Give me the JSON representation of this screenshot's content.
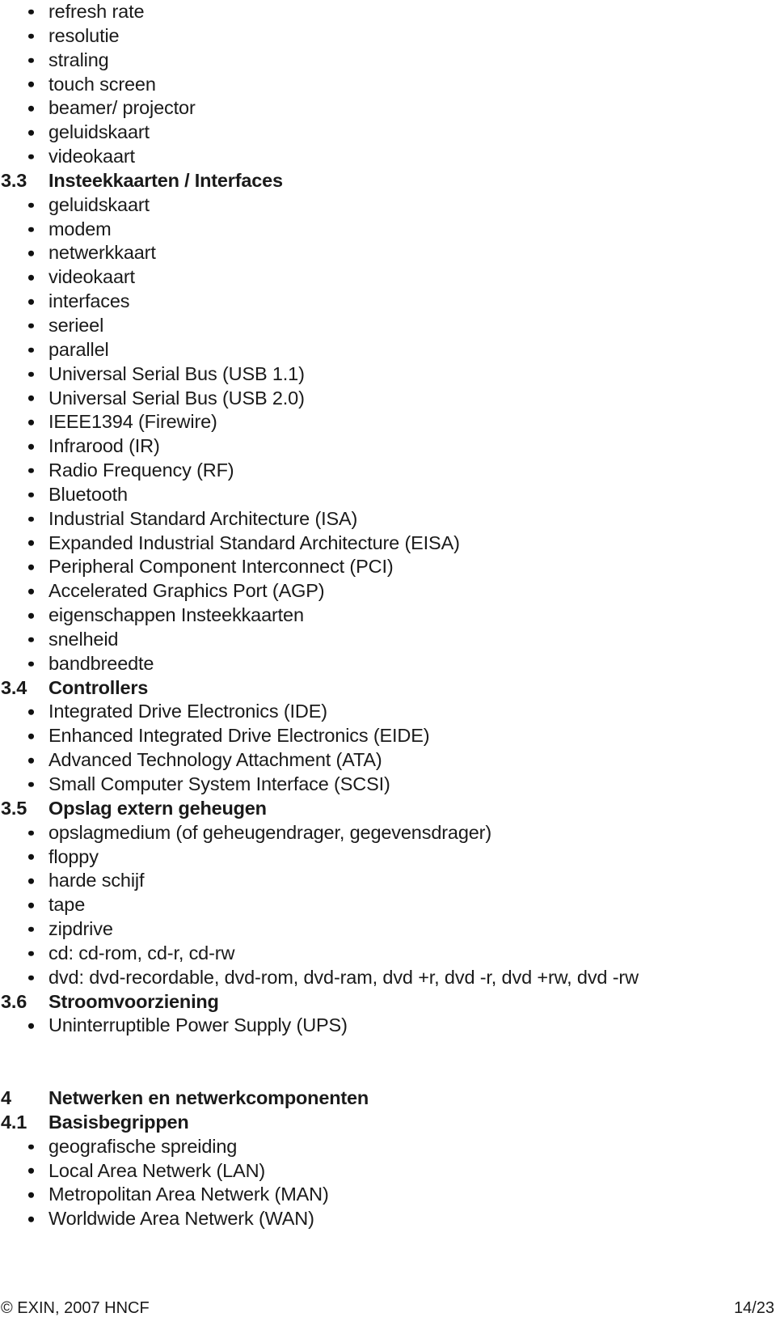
{
  "document": {
    "blocks": [
      {
        "type": "bullet",
        "text": "refresh rate"
      },
      {
        "type": "bullet",
        "text": "resolutie"
      },
      {
        "type": "bullet",
        "text": "straling"
      },
      {
        "type": "bullet",
        "text": "touch screen"
      },
      {
        "type": "bullet",
        "text": "beamer/ projector"
      },
      {
        "type": "bullet",
        "text": "geluidskaart"
      },
      {
        "type": "bullet",
        "text": "videokaart"
      },
      {
        "type": "heading",
        "number": "3.3",
        "text": "Insteekkaarten / Interfaces"
      },
      {
        "type": "bullet",
        "text": "geluidskaart"
      },
      {
        "type": "bullet",
        "text": "modem"
      },
      {
        "type": "bullet",
        "text": "netwerkkaart"
      },
      {
        "type": "bullet",
        "text": "videokaart"
      },
      {
        "type": "bullet",
        "text": "interfaces"
      },
      {
        "type": "bullet",
        "text": "serieel"
      },
      {
        "type": "bullet",
        "text": "parallel"
      },
      {
        "type": "bullet",
        "text": "Universal Serial Bus (USB 1.1)"
      },
      {
        "type": "bullet",
        "text": "Universal Serial Bus (USB 2.0)"
      },
      {
        "type": "bullet",
        "text": "IEEE1394 (Firewire)"
      },
      {
        "type": "bullet",
        "text": "Infrarood (IR)"
      },
      {
        "type": "bullet",
        "text": "Radio Frequency (RF)"
      },
      {
        "type": "bullet",
        "text": "Bluetooth"
      },
      {
        "type": "bullet",
        "text": "Industrial Standard Architecture (ISA)"
      },
      {
        "type": "bullet",
        "text": "Expanded Industrial Standard Architecture (EISA)"
      },
      {
        "type": "bullet",
        "text": "Peripheral Component Interconnect (PCI)"
      },
      {
        "type": "bullet",
        "text": "Accelerated Graphics Port (AGP)"
      },
      {
        "type": "bullet",
        "text": "eigenschappen Insteekkaarten"
      },
      {
        "type": "bullet",
        "text": "snelheid"
      },
      {
        "type": "bullet",
        "text": "bandbreedte"
      },
      {
        "type": "heading",
        "number": "3.4",
        "text": "Controllers"
      },
      {
        "type": "bullet",
        "text": "Integrated Drive Electronics (IDE)"
      },
      {
        "type": "bullet",
        "text": "Enhanced Integrated Drive Electronics (EIDE)"
      },
      {
        "type": "bullet",
        "text": "Advanced Technology Attachment (ATA)"
      },
      {
        "type": "bullet",
        "text": "Small Computer System Interface (SCSI)"
      },
      {
        "type": "heading",
        "number": "3.5",
        "text": "Opslag extern geheugen"
      },
      {
        "type": "bullet",
        "text": "opslagmedium (of geheugendrager, gegevensdrager)"
      },
      {
        "type": "bullet",
        "text": "floppy"
      },
      {
        "type": "bullet",
        "text": "harde schijf"
      },
      {
        "type": "bullet",
        "text": "tape"
      },
      {
        "type": "bullet",
        "text": "zipdrive"
      },
      {
        "type": "bullet",
        "text": "cd: cd-rom, cd-r, cd-rw"
      },
      {
        "type": "bullet",
        "text": "dvd: dvd-recordable, dvd-rom, dvd-ram, dvd +r, dvd -r, dvd +rw, dvd -rw"
      },
      {
        "type": "heading",
        "number": "3.6",
        "text": "Stroomvoorziening"
      },
      {
        "type": "bullet",
        "text": "Uninterruptible Power Supply (UPS)"
      },
      {
        "type": "spacer"
      },
      {
        "type": "spacer"
      },
      {
        "type": "heading",
        "number": "4",
        "text": "Netwerken en netwerkcomponenten"
      },
      {
        "type": "heading",
        "number": "4.1",
        "text": "Basisbegrippen"
      },
      {
        "type": "bullet",
        "text": "geografische spreiding"
      },
      {
        "type": "bullet",
        "text": "Local Area Netwerk (LAN)"
      },
      {
        "type": "bullet",
        "text": "Metropolitan Area Netwerk (MAN)"
      },
      {
        "type": "bullet",
        "text": "Worldwide Area Netwerk (WAN)"
      }
    ]
  },
  "footer": {
    "copyright": "© EXIN, 2007 HNCF",
    "page_number": "14/23"
  },
  "colors": {
    "text": "#1a1a1a",
    "background": "#ffffff",
    "bullet": "#111111"
  }
}
